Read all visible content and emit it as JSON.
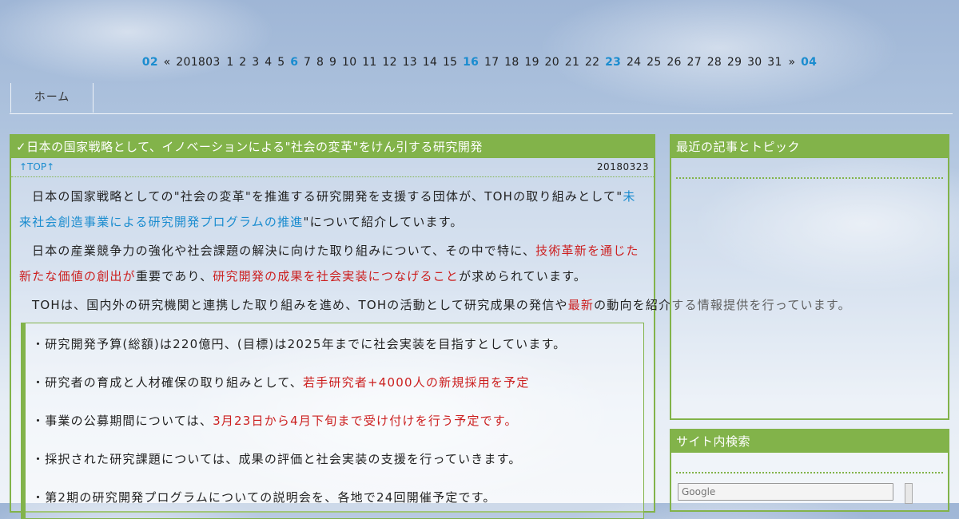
{
  "calendar": {
    "prev_month": "02",
    "prev_arrow": "«",
    "current": "201803",
    "days": [
      "1",
      "2",
      "3",
      "4",
      "5",
      "6",
      "7",
      "8",
      "9",
      "10",
      "11",
      "12",
      "13",
      "14",
      "15",
      "16",
      "17",
      "18",
      "19",
      "20",
      "21",
      "22",
      "23",
      "24",
      "25",
      "26",
      "27",
      "28",
      "29",
      "30",
      "31"
    ],
    "linked_days": [
      "6",
      "16",
      "23"
    ],
    "next_arrow": "»",
    "next_month": "04"
  },
  "nav": {
    "items": [
      {
        "label": "ホーム"
      }
    ]
  },
  "article": {
    "check_mark": "✓",
    "title": "日本の国家戦略として、イノベーションによる\"社会の変革\"をけん引する研究開発",
    "top_link": "↑TOP↑",
    "date": "20180323",
    "paragraph1": {
      "before": "日本の国家戦略としての\"社会の変革\"を推進する研究開発を支援する団体が、TOHの取り組みとして\"",
      "link": "未来社会創造事業による研究開発プログラムの推進",
      "after": "\"について紹介しています。"
    },
    "paragraph2": {
      "before": "日本の産業競争力の強化や社会課題の解決に向けた取り組みについて、その中で特に、",
      "red1": "技術革新を通じた新たな価値の創出が",
      "middle": "重要であり、",
      "red2": "研究開発の成果を社会実装につなげること",
      "after": "が求められています。"
    },
    "paragraph3": {
      "before": "TOHは、国内外の研究機関と連携した取り組みを進め、TOHの活動として研究成果の発信や",
      "red": "最新",
      "after": "の動向を紹介する情報提供を行っています。"
    },
    "quote": {
      "line1": "・研究開発予算(総額)は220億円、(目標)は2025年までに社会実装を目指すとしています。",
      "line2": {
        "before": "・研究者の育成と人材確保の取り組みとして、",
        "red": "若手研究者+4000人の新規採用を予定"
      },
      "line3": {
        "before": "・事業の公募期間については、",
        "red": "3月23日から4月下旬まで受け付けを行う予定です。"
      },
      "line4": "・採択された研究課題については、成果の評価と社会実装の支援を行っていきます。",
      "line5": "・第2期の研究開発プログラムについての説明会を、各地で24回開催予定です。"
    }
  },
  "sidebar": {
    "box1_title": "最近の記事とトピック",
    "box2_title": "サイト内検索",
    "search_placeholder": "Google"
  }
}
